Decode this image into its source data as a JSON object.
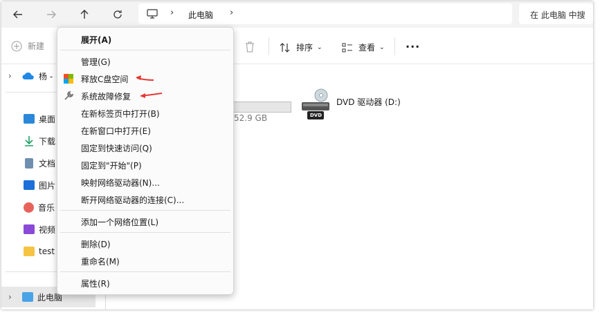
{
  "address_bar": {
    "location_label": "此电脑",
    "search_placeholder": "在 此电脑 中搜"
  },
  "toolbar": {
    "new_label": "新建",
    "sort_label": "排序",
    "view_label": "查看"
  },
  "sidebar": {
    "items": [
      {
        "label": "杨 -",
        "icon": "onedrive-cloud-icon"
      },
      {
        "label": "桌面",
        "icon": "desktop-icon"
      },
      {
        "label": "下载",
        "icon": "download-icon"
      },
      {
        "label": "文档",
        "icon": "document-icon"
      },
      {
        "label": "图片",
        "icon": "picture-icon"
      },
      {
        "label": "音乐",
        "icon": "music-icon"
      },
      {
        "label": "视频",
        "icon": "video-icon"
      },
      {
        "label": "test",
        "icon": "folder-icon"
      },
      {
        "label": "此电脑",
        "icon": "computer-icon"
      }
    ]
  },
  "content": {
    "drive_size_text": "52.9 GB",
    "dvd_drive_label": "DVD 驱动器 (D:)",
    "dvd_badge": "DVD"
  },
  "context_menu": {
    "items": [
      {
        "label": "展开(A)",
        "bold": true
      },
      {
        "label": "管理(G)"
      },
      {
        "label": "释放C盘空间",
        "icon": "windows-cleanup-icon"
      },
      {
        "label": "系统故障修复",
        "icon": "wrench-icon"
      },
      {
        "label": "在新标签页中打开(B)"
      },
      {
        "label": "在新窗口中打开(E)"
      },
      {
        "label": "固定到快速访问(Q)"
      },
      {
        "label": "固定到\"开始\"(P)"
      },
      {
        "label": "映射网络驱动器(N)..."
      },
      {
        "label": "断开网络驱动器的连接(C)..."
      },
      {
        "label": "添加一个网络位置(L)"
      },
      {
        "label": "删除(D)"
      },
      {
        "label": "重命名(M)"
      },
      {
        "label": "属性(R)"
      }
    ]
  },
  "colors": {
    "annotation_arrow": "#e53935",
    "selection": "#e8e8e8",
    "accent_blue": "#1e88e5"
  }
}
